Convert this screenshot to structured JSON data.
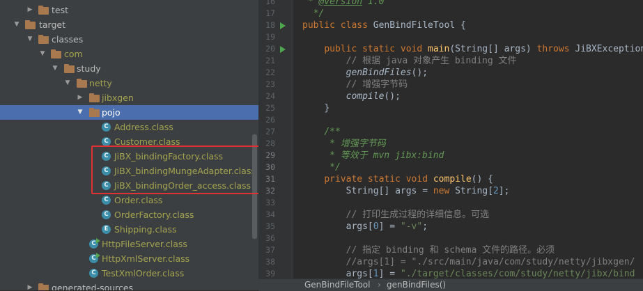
{
  "tree": {
    "rows": [
      {
        "label": "test",
        "kind": "folder",
        "arrow": "right"
      },
      {
        "label": "target",
        "kind": "folder",
        "arrow": "down"
      },
      {
        "label": "classes",
        "kind": "folder",
        "arrow": "down"
      },
      {
        "label": "com",
        "kind": "folder",
        "arrow": "down"
      },
      {
        "label": "study",
        "kind": "folder",
        "arrow": "down"
      },
      {
        "label": "netty",
        "kind": "folder",
        "arrow": "down"
      },
      {
        "label": "jibxgen",
        "kind": "folder",
        "arrow": "right"
      },
      {
        "label": "pojo",
        "kind": "folder",
        "arrow": "down",
        "selected": true
      },
      {
        "label": "Address.class",
        "kind": "class",
        "badge": "C"
      },
      {
        "label": "Customer.class",
        "kind": "class",
        "badge": "C"
      },
      {
        "label": "JiBX_bindingFactory.class",
        "kind": "class",
        "badge": "C"
      },
      {
        "label": "JiBX_bindingMungeAdapter.class",
        "kind": "class",
        "badge": "C"
      },
      {
        "label": "JiBX_bindingOrder_access.class",
        "kind": "class",
        "badge": "C"
      },
      {
        "label": "Order.class",
        "kind": "class",
        "badge": "C"
      },
      {
        "label": "OrderFactory.class",
        "kind": "class",
        "badge": "C"
      },
      {
        "label": "Shipping.class",
        "kind": "class",
        "badge": "E"
      },
      {
        "label": "HttpFileServer.class",
        "kind": "class",
        "badge": "C",
        "run": true
      },
      {
        "label": "HttpXmlServer.class",
        "kind": "class",
        "badge": "C",
        "run": true
      },
      {
        "label": "TestXmlOrder.class",
        "kind": "class",
        "badge": "C"
      },
      {
        "label": "generated-sources",
        "kind": "folder",
        "arrow": "right"
      }
    ]
  },
  "editor": {
    "line_numbers": [
      "16",
      "17",
      "18",
      "19",
      "20",
      "21",
      "22",
      "23",
      "24",
      "25",
      "26",
      "27",
      "28",
      "29",
      "30",
      "31",
      "32",
      "33",
      "34",
      "35",
      "36",
      "37",
      "38",
      "39"
    ],
    "code": {
      "l16_tag": "@version",
      "l16_rest": " 1.0",
      "l17": "*/",
      "l18_a": "public class ",
      "l18_b": "GenBindFileTool {",
      "l20_a": "public static void ",
      "l20_b": "main",
      "l20_c": "(String[] args) ",
      "l20_d": "throws ",
      "l20_e": "JiBXException",
      "l21": "// 根据 java 对象产生 binding 文件",
      "l22_a": "genBindFiles",
      "l22_b": "();",
      "l23": "// 增强字节码",
      "l24_a": "compile",
      "l24_b": "();",
      "l25": "}",
      "l27": "/**",
      "l28": "* 增强字节码",
      "l29": "* 等效于 mvn jibx:bind",
      "l30": "*/",
      "l31_a": "private static void ",
      "l31_b": "compile",
      "l31_c": "() {",
      "l32_a": "String[] args = ",
      "l32_b": "new ",
      "l32_c": "String[",
      "l32_d": "2",
      "l32_e": "];",
      "l34": "// 打印生成过程的详细信息。可选",
      "l35_a": "args[",
      "l35_b": "0",
      "l35_c": "] = ",
      "l35_d": "\"-v\"",
      "l35_e": ";",
      "l37": "// 指定 binding 和 schema 文件的路径。必须",
      "l38": "//args[1] = \"./src/main/java/com/study/netty/jibxgen/",
      "l39_a": "args[",
      "l39_b": "1",
      "l39_c": "] = ",
      "l39_d": "\"./target/classes/com/study/netty/jibx/bind"
    }
  },
  "breadcrumb": {
    "class_name": "GenBindFileTool",
    "method_name": "genBindFiles()"
  },
  "colors": {
    "selection": "#4b6eaf",
    "highlight_box": "#e03232",
    "keyword": "#cc7832",
    "javadoc": "#629755"
  }
}
